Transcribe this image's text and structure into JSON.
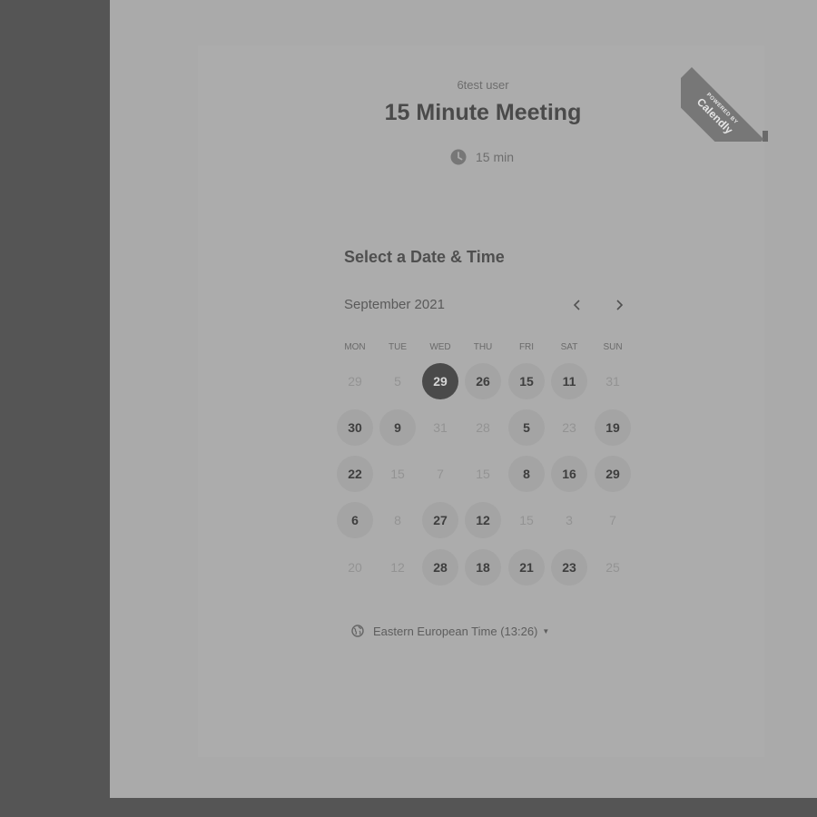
{
  "colors": {
    "outer_background": "#555555",
    "page_background": "#aaaaaa",
    "selected_day": "#4a4a4a",
    "available_day": "#a4a4a4"
  },
  "branding": {
    "powered_by": "POWERED BY",
    "brand": "Calendly"
  },
  "event": {
    "owner": "6test user",
    "title": "15 Minute Meeting",
    "duration": "15 min",
    "duration_icon": "clock-icon"
  },
  "calendar": {
    "heading": "Select a Date & Time",
    "month": "September 2021",
    "prev_icon": "chevron-left-icon",
    "next_icon": "chevron-right-icon",
    "weekdays": [
      "MON",
      "TUE",
      "WED",
      "THU",
      "FRI",
      "SAT",
      "SUN"
    ],
    "weeks": [
      [
        {
          "label": "29",
          "state": "unavailable"
        },
        {
          "label": "5",
          "state": "unavailable"
        },
        {
          "label": "29",
          "state": "selected"
        },
        {
          "label": "26",
          "state": "available"
        },
        {
          "label": "15",
          "state": "available"
        },
        {
          "label": "11",
          "state": "available"
        },
        {
          "label": "31",
          "state": "unavailable"
        }
      ],
      [
        {
          "label": "30",
          "state": "available"
        },
        {
          "label": "9",
          "state": "available"
        },
        {
          "label": "31",
          "state": "unavailable"
        },
        {
          "label": "28",
          "state": "unavailable"
        },
        {
          "label": "5",
          "state": "available"
        },
        {
          "label": "23",
          "state": "unavailable"
        },
        {
          "label": "19",
          "state": "available"
        }
      ],
      [
        {
          "label": "22",
          "state": "available"
        },
        {
          "label": "15",
          "state": "unavailable"
        },
        {
          "label": "7",
          "state": "unavailable"
        },
        {
          "label": "15",
          "state": "unavailable"
        },
        {
          "label": "8",
          "state": "available"
        },
        {
          "label": "16",
          "state": "available"
        },
        {
          "label": "29",
          "state": "available"
        }
      ],
      [
        {
          "label": "6",
          "state": "available"
        },
        {
          "label": "8",
          "state": "unavailable"
        },
        {
          "label": "27",
          "state": "available"
        },
        {
          "label": "12",
          "state": "available"
        },
        {
          "label": "15",
          "state": "unavailable"
        },
        {
          "label": "3",
          "state": "unavailable"
        },
        {
          "label": "7",
          "state": "unavailable"
        }
      ],
      [
        {
          "label": "20",
          "state": "unavailable"
        },
        {
          "label": "12",
          "state": "unavailable"
        },
        {
          "label": "28",
          "state": "available"
        },
        {
          "label": "18",
          "state": "available"
        },
        {
          "label": "21",
          "state": "available"
        },
        {
          "label": "23",
          "state": "available"
        },
        {
          "label": "25",
          "state": "unavailable"
        }
      ]
    ]
  },
  "timezone": {
    "icon": "globe-icon",
    "label": "Eastern European Time (13:26)"
  }
}
